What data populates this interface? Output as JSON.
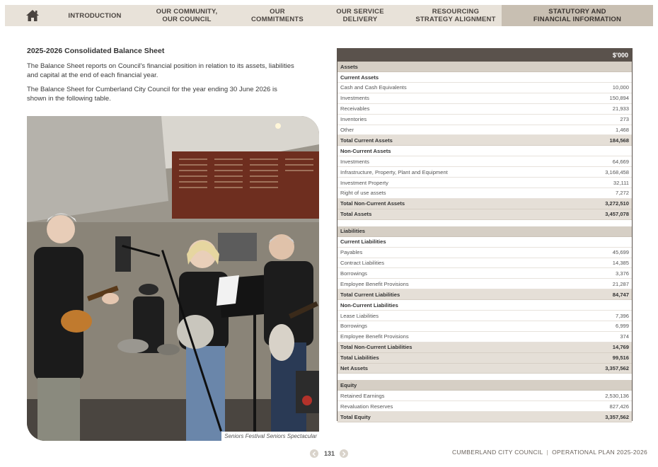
{
  "nav": {
    "home_icon": "home-icon",
    "items": [
      {
        "label": "INTRODUCTION",
        "active": false
      },
      {
        "label": "OUR COMMUNITY,\nOUR COUNCIL",
        "active": false
      },
      {
        "label": "OUR\nCOMMITMENTS",
        "active": false
      },
      {
        "label": "OUR SERVICE\nDELIVERY",
        "active": false
      },
      {
        "label": "RESOURCING\nSTRATEGY ALIGNMENT",
        "active": false
      },
      {
        "label": "STATUTORY AND\nFINANCIAL INFORMATION",
        "active": true
      }
    ]
  },
  "content": {
    "title": "2025-2026 Consolidated Balance Sheet",
    "para1": "The Balance Sheet reports on Council's financial position in relation to its assets, liabilities and capital at the end of each financial year.",
    "para2": "The Balance Sheet for Cumberland City Council for the year ending 30 June 2026 is shown in the following table.",
    "photo_caption": "Seniors Festival Seniors Spectacular"
  },
  "table": {
    "unit_header": "$'000",
    "rows": [
      {
        "type": "section",
        "label": "Assets",
        "value": ""
      },
      {
        "type": "sub",
        "label": "Current Assets",
        "value": ""
      },
      {
        "type": "item",
        "label": "Cash and Cash Equivalents",
        "value": "10,000"
      },
      {
        "type": "item",
        "label": "Investments",
        "value": "150,894"
      },
      {
        "type": "item",
        "label": "Receivables",
        "value": "21,933"
      },
      {
        "type": "item",
        "label": "Inventories",
        "value": "273"
      },
      {
        "type": "item",
        "label": "Other",
        "value": "1,468"
      },
      {
        "type": "total",
        "label": "Total Current Assets",
        "value": "184,568"
      },
      {
        "type": "sub",
        "label": "Non-Current Assets",
        "value": ""
      },
      {
        "type": "item",
        "label": "Investments",
        "value": "64,669"
      },
      {
        "type": "item",
        "label": "Infrastructure, Property, Plant and Equipment",
        "value": "3,168,458"
      },
      {
        "type": "item",
        "label": "Investment Property",
        "value": "32,111"
      },
      {
        "type": "item",
        "label": "Right of use assets",
        "value": "7,272"
      },
      {
        "type": "total",
        "label": "Total Non-Current Assets",
        "value": "3,272,510"
      },
      {
        "type": "total",
        "label": "Total Assets",
        "value": "3,457,078"
      },
      {
        "type": "spacer",
        "label": "",
        "value": ""
      },
      {
        "type": "section",
        "label": "Liabilities",
        "value": ""
      },
      {
        "type": "sub",
        "label": "Current Liabilities",
        "value": ""
      },
      {
        "type": "item",
        "label": "Payables",
        "value": "45,699"
      },
      {
        "type": "item",
        "label": "Contract Liabilities",
        "value": "14,385"
      },
      {
        "type": "item",
        "label": "Borrowings",
        "value": "3,376"
      },
      {
        "type": "item",
        "label": "Employee Benefit Provisions",
        "value": "21,287"
      },
      {
        "type": "total",
        "label": "Total Current Liabilities",
        "value": "84,747"
      },
      {
        "type": "sub",
        "label": "Non-Current Liabilities",
        "value": ""
      },
      {
        "type": "item",
        "label": "Lease Liabilities",
        "value": "7,396"
      },
      {
        "type": "item",
        "label": "Borrowings",
        "value": "6,999"
      },
      {
        "type": "item",
        "label": "Employee Benefit Provisions",
        "value": "374"
      },
      {
        "type": "total",
        "label": "Total Non-Current Liabilities",
        "value": "14,769"
      },
      {
        "type": "total",
        "label": "Total Liabilities",
        "value": "99,516"
      },
      {
        "type": "total",
        "label": "Net Assets",
        "value": "3,357,562"
      },
      {
        "type": "spacer",
        "label": "",
        "value": ""
      },
      {
        "type": "section",
        "label": "Equity",
        "value": ""
      },
      {
        "type": "item",
        "label": "Retained Earnings",
        "value": "2,530,136"
      },
      {
        "type": "item",
        "label": "Revaluation Reserves",
        "value": "827,426"
      },
      {
        "type": "total",
        "label": "Total Equity",
        "value": "3,357,562"
      }
    ]
  },
  "footer": {
    "page_number": "131",
    "org": "CUMBERLAND CITY COUNCIL",
    "doc": "OPERATIONAL PLAN 2025-2026",
    "prev_icon": "chevron-left-icon",
    "next_icon": "chevron-right-icon"
  },
  "colors": {
    "nav_bg": "#e8e2d9",
    "nav_active": "#c8bfb2",
    "table_header": "#5a524c",
    "section_row": "#d6cfc5",
    "total_row": "#e5dfd7"
  }
}
